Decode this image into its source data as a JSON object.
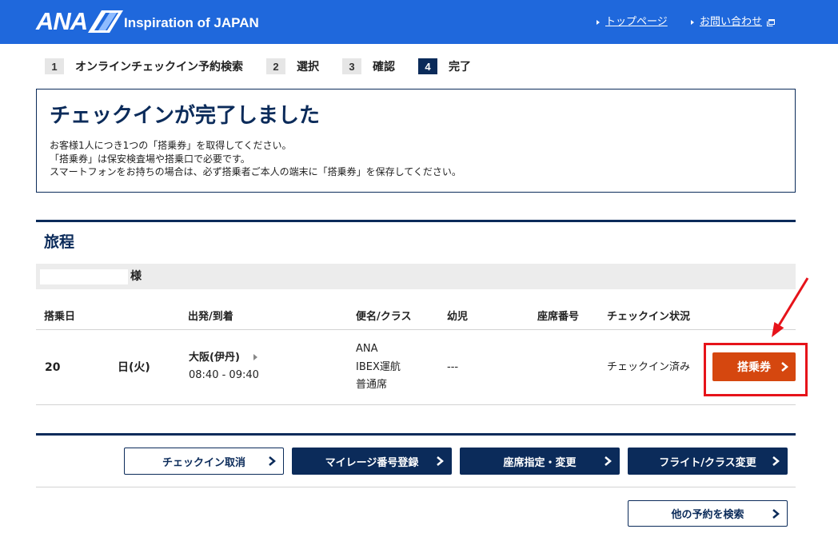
{
  "header": {
    "logo_text": "ANA",
    "tagline": "Inspiration of JAPAN",
    "links": [
      {
        "label": "トップページ",
        "icon": "triangle-right-icon"
      },
      {
        "label": "お問い合わせ",
        "icon": "triangle-right-icon",
        "suffix_icon": "external-window-icon"
      }
    ]
  },
  "steps": [
    {
      "number": "1",
      "label": "オンラインチェックイン予約検索",
      "active": false
    },
    {
      "number": "2",
      "label": "選択",
      "active": false
    },
    {
      "number": "3",
      "label": "確認",
      "active": false
    },
    {
      "number": "4",
      "label": "完了",
      "active": true
    }
  ],
  "notice": {
    "title": "チェックインが完了しました",
    "lines": [
      "お客様1人につき1つの「搭乗券」を取得してください。",
      "「搭乗券」は保安検査場や搭乗口で必要です。",
      "スマートフォンをお持ちの場合は、必ず搭乗者ご本人の端末に「搭乗券」を保存してください。"
    ]
  },
  "itinerary": {
    "heading": "旅程",
    "passenger_suffix": "様",
    "columns": [
      "搭乗日",
      "出発/到着",
      "便名/クラス",
      "幼児",
      "座席番号",
      "チェックイン状況"
    ],
    "row": {
      "date_prefix": "20",
      "date_suffix": "日(火)",
      "route": "大阪(伊丹)",
      "time": "08:40 - 09:40",
      "airline": "ANA",
      "operator": "IBEX運航",
      "cabin_class": "普通席",
      "infant": "---",
      "status": "チェックイン済み",
      "boarding_pass_button": "搭乗券",
      "button_icon": "chevron-right-icon"
    }
  },
  "actions": [
    {
      "label": "チェックイン取消",
      "icon": "chevron-right-icon"
    },
    {
      "label": "マイレージ番号登録",
      "icon": "chevron-right-icon"
    },
    {
      "label": "座席指定・変更",
      "icon": "chevron-right-icon"
    },
    {
      "label": "フライト/クラス変更",
      "icon": "chevron-right-icon"
    }
  ],
  "search_other": {
    "label": "他の予約を検索",
    "icon": "chevron-right-icon"
  },
  "colors": {
    "header_background": "#1f68dc",
    "navy": "#0b2b5a",
    "boarding_pass_button": "#d5470f",
    "annotation_red": "#e6131a"
  }
}
